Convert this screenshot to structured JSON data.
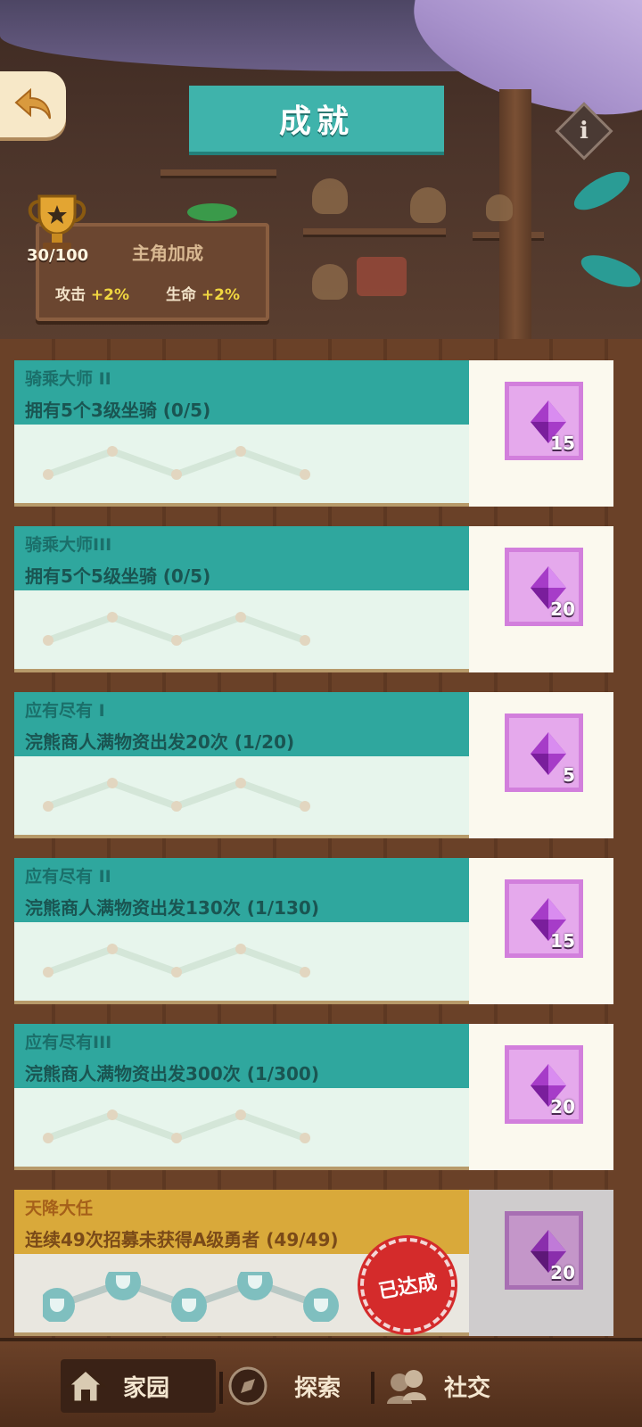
{
  "header": {
    "title": "成就",
    "trophy_count": "30/100",
    "bonus_title": "主角加成",
    "bonus": [
      {
        "label": "攻击",
        "value": "+2%"
      },
      {
        "label": "生命",
        "value": "+2%"
      }
    ]
  },
  "icons": {
    "back": "back-arrow-icon",
    "info": "info-icon",
    "trophy": "trophy-icon",
    "gem": "purple-gem-icon",
    "home": "home-icon",
    "explore": "explore-icon",
    "social": "social-icon"
  },
  "colors": {
    "teal": "#2fa79e",
    "gold": "#d9a93a",
    "gem_bg": "#e5a9ec",
    "stamp_red": "#d42b2b"
  },
  "achievements": [
    {
      "name": "骑乘大师 II",
      "desc": "拥有5个3级坐骑 (0/5)",
      "reward": "15",
      "completed": false
    },
    {
      "name": "骑乘大师III",
      "desc": "拥有5个5级坐骑 (0/5)",
      "reward": "20",
      "completed": false
    },
    {
      "name": "应有尽有 I",
      "desc": "浣熊商人满物资出发20次 (1/20)",
      "reward": "5",
      "completed": false
    },
    {
      "name": "应有尽有 II",
      "desc": "浣熊商人满物资出发130次 (1/130)",
      "reward": "15",
      "completed": false
    },
    {
      "name": "应有尽有III",
      "desc": "浣熊商人满物资出发300次 (1/300)",
      "reward": "20",
      "completed": false
    },
    {
      "name": "天降大任",
      "desc": "连续49次招募未获得A级勇者 (49/49)",
      "reward": "20",
      "completed": true,
      "stamp": "已达成"
    }
  ],
  "nav": [
    {
      "label": "家园",
      "active": true
    },
    {
      "label": "探索",
      "active": false
    },
    {
      "label": "社交",
      "active": false
    }
  ]
}
